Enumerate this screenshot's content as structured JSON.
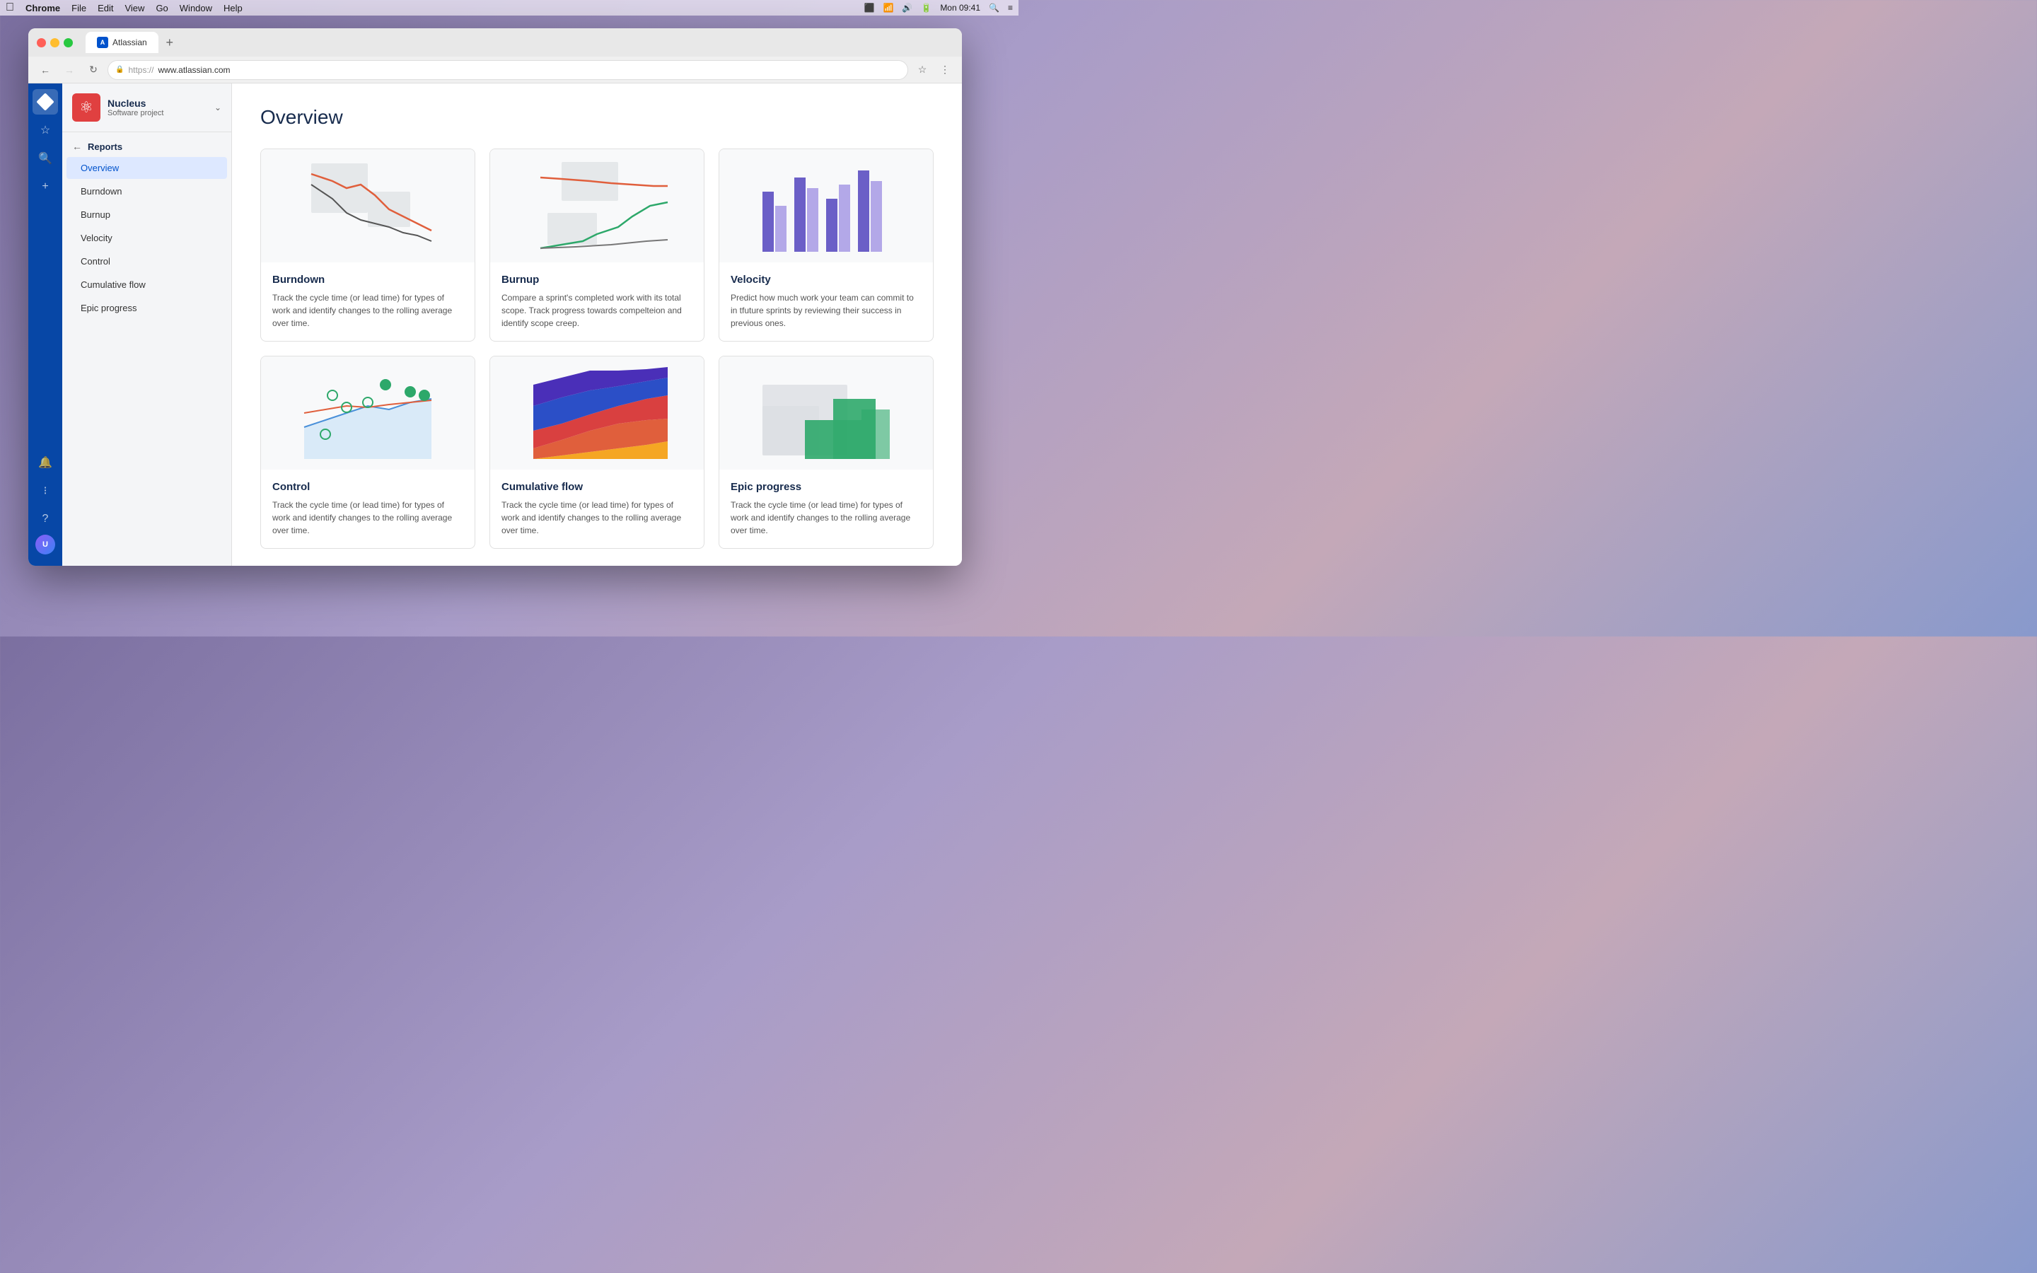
{
  "menubar": {
    "apple": "⌘",
    "chrome": "Chrome",
    "file": "File",
    "edit": "Edit",
    "view": "View",
    "go": "Go",
    "window": "Window",
    "help": "Help",
    "time": "Mon 09:41"
  },
  "browser": {
    "tab_label": "Atlassian",
    "url_protocol": "https://",
    "url_domain": "www.atlassian.com",
    "add_tab": "+"
  },
  "sidebar": {
    "diamond": "◆",
    "star": "☆",
    "search": "⌕",
    "plus": "+",
    "bell": "🔔",
    "grid": "⊞",
    "help": "?"
  },
  "project": {
    "name": "Nucleus",
    "type": "Software project",
    "logo": "⚛"
  },
  "nav": {
    "section": "Reports",
    "overview": "Overview",
    "burndown": "Burndown",
    "burnup": "Burnup",
    "velocity": "Velocity",
    "control": "Control",
    "cumulative_flow": "Cumulative flow",
    "epic_progress": "Epic progress"
  },
  "page": {
    "title": "Overview"
  },
  "cards": [
    {
      "id": "burndown",
      "title": "Burndown",
      "desc": "Track the cycle time (or lead time) for types of work and identify changes to the rolling average over time.",
      "chart_type": "burndown"
    },
    {
      "id": "burnup",
      "title": "Burnup",
      "desc": "Compare a sprint's completed work with its total scope. Track progress towards compelteion and identify scope creep.",
      "chart_type": "burnup"
    },
    {
      "id": "velocity",
      "title": "Velocity",
      "desc": "Predict how much work your team can commit to in tfuture sprints by reviewing their success in previous ones.",
      "chart_type": "velocity"
    },
    {
      "id": "control",
      "title": "Control",
      "desc": "Track the cycle time (or lead time) for types of work and identify changes to the rolling average over time.",
      "chart_type": "control"
    },
    {
      "id": "cumulative_flow",
      "title": "Cumulative flow",
      "desc": "Track the cycle time (or lead time) for types of work and identify changes to the rolling average over time.",
      "chart_type": "cumulative"
    },
    {
      "id": "epic_progress",
      "title": "Epic progress",
      "desc": "Track the cycle time (or lead time) for types of work and identify changes to the rolling average over time.",
      "chart_type": "epic"
    }
  ]
}
